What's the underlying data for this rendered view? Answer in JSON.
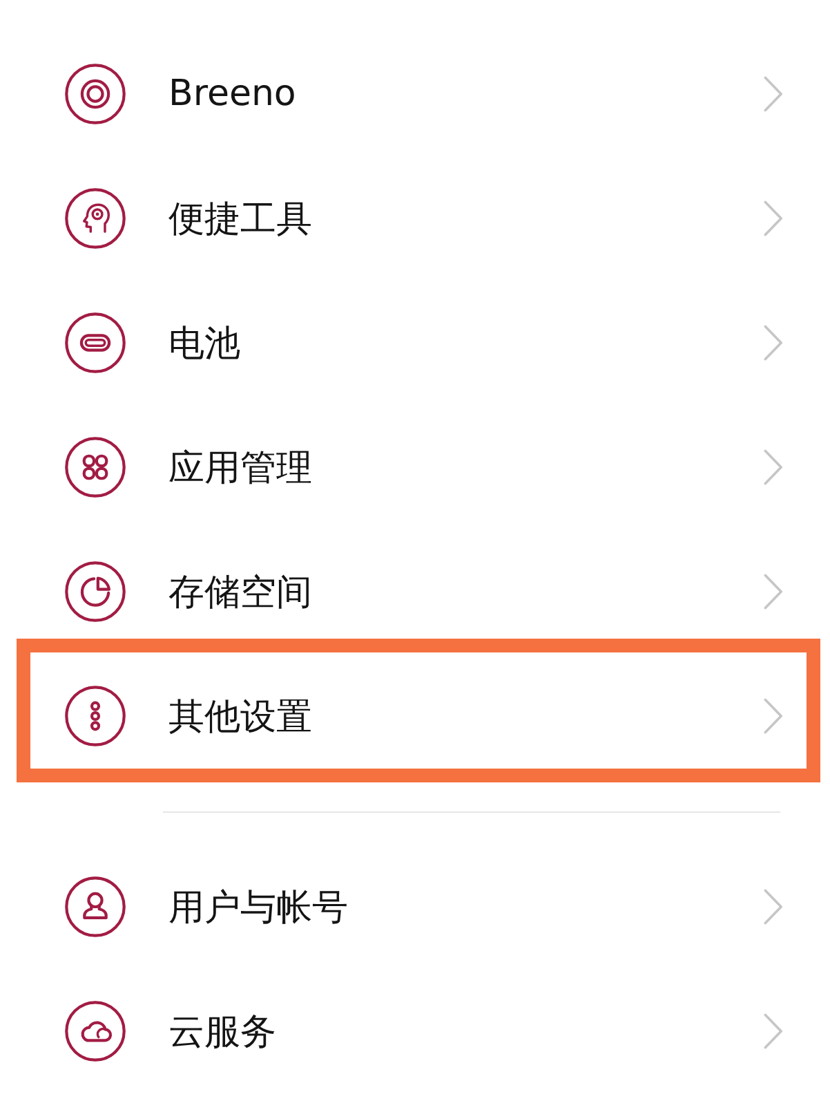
{
  "groups": [
    {
      "items": [
        {
          "label": "Breeno",
          "highlighted": false
        },
        {
          "label": "便捷工具",
          "highlighted": false
        },
        {
          "label": "电池",
          "highlighted": false
        },
        {
          "label": "应用管理",
          "highlighted": false
        },
        {
          "label": "存储空间",
          "highlighted": false
        },
        {
          "label": "其他设置",
          "highlighted": true
        }
      ]
    },
    {
      "items": [
        {
          "label": "用户与帐号",
          "highlighted": false
        },
        {
          "label": "云服务",
          "highlighted": false
        }
      ]
    }
  ]
}
